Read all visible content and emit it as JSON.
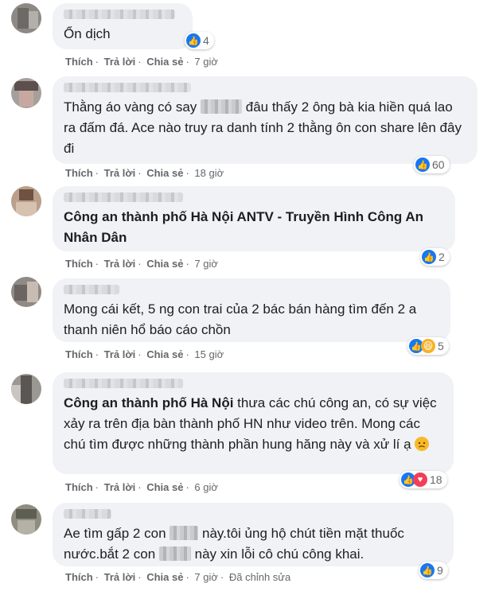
{
  "comments": [
    {
      "text": "Ổn dịch",
      "reactions": "4",
      "actions": {
        "like": "Thích",
        "reply": "Trả lời",
        "share": "Chia sẻ",
        "time": "7 giờ"
      }
    },
    {
      "text_a": "Thằng áo vàng có say",
      "text_b": "đâu thấy 2 ông bà kia hiền quá lao ra đấm đá. Ace nào truy ra danh tính 2 thằng ôn con share lên đây đi",
      "reactions": "60",
      "actions": {
        "like": "Thích",
        "reply": "Trả lời",
        "share": "Chia sẻ",
        "time": "18 giờ"
      }
    },
    {
      "tag": "Công an thành phố Hà Nội ANTV - Truyền Hình Công An Nhân Dân",
      "reactions": "2",
      "actions": {
        "like": "Thích",
        "reply": "Trả lời",
        "share": "Chia sẻ",
        "time": "7 giờ"
      }
    },
    {
      "text": "Mong cái kết, 5 ng con trai của 2 bác bán hàng tìm đến 2 a thanh niên hổ báo cáo chồn",
      "reactions": "5",
      "actions": {
        "like": "Thích",
        "reply": "Trả lời",
        "share": "Chia sẻ",
        "time": "15 giờ"
      }
    },
    {
      "tag": "Công an thành phố Hà Nội",
      "text": "thưa các chú công an, có sự việc xảy ra trên địa bàn thành phố HN như video trên. Mong các chú tìm được những thành phần hung hăng này và xử lí ạ",
      "reactions": "18",
      "actions": {
        "like": "Thích",
        "reply": "Trả lời",
        "share": "Chia sẻ",
        "time": "6 giờ"
      }
    },
    {
      "text_a": "Ae tìm gấp 2 con",
      "text_b": "này.tôi ủng hộ chút tiền mặt thuốc nước.bắt 2 con",
      "text_c": "này xin lỗi cô chú công khai.",
      "reactions": "9",
      "actions": {
        "like": "Thích",
        "reply": "Trả lời",
        "share": "Chia sẻ",
        "time": "7 giờ",
        "edited": "Đã chỉnh sửa"
      }
    }
  ]
}
